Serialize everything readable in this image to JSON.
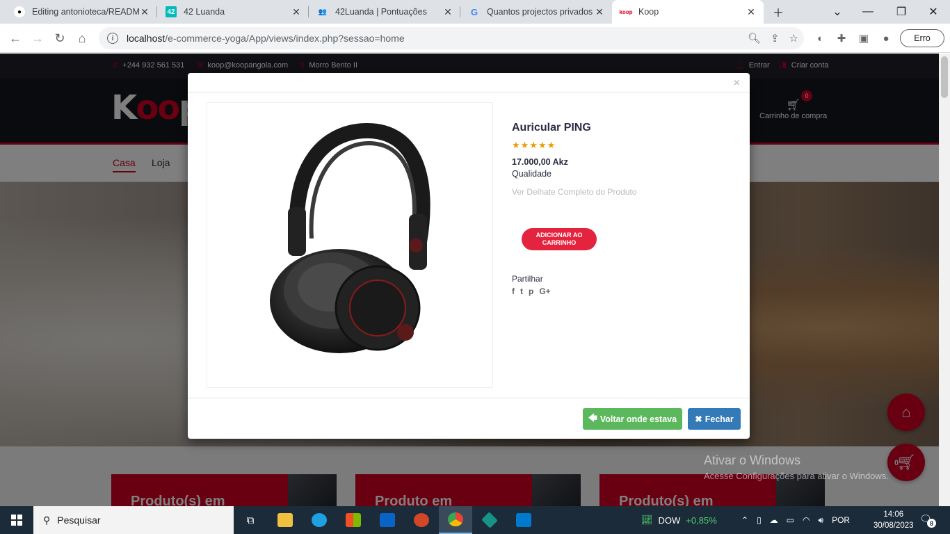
{
  "browser": {
    "tabs": [
      {
        "title": "Editing antonioteca/READMI",
        "favicon": "github-icon"
      },
      {
        "title": "42 Luanda",
        "favicon": "42-icon"
      },
      {
        "title": "42Luanda | Pontuações",
        "favicon": "users-icon"
      },
      {
        "title": "Quantos projectos privados c",
        "favicon": "google-icon"
      },
      {
        "title": "Koop",
        "favicon": "koop-icon",
        "active": true
      }
    ],
    "url_host": "localhost",
    "url_path": "/e-commerce-yoga/App/views/index.php?sessao=home",
    "profile_button": "Erro"
  },
  "site": {
    "topbar": {
      "phone": "+244 932 561 531",
      "email": "koop@koopangola.com",
      "location": "Morro Bento II",
      "login": "Entrar",
      "register": "Criar conta"
    },
    "logo": "Koop",
    "cart": {
      "label": "Carrinho de compra",
      "count": "0"
    },
    "nav": [
      "Casa",
      "Loja"
    ],
    "product_cards": [
      {
        "title": "Produto(s) em"
      },
      {
        "title": "Produto em"
      },
      {
        "title": "Produto(s) em"
      }
    ],
    "floating_cart_count": "0"
  },
  "modal": {
    "close_glyph": "×",
    "product": {
      "name": "Auricular PING",
      "stars": "★★★★★",
      "price": "17.000,00 Akz",
      "quality": "Qualidade",
      "detail_link": "Ver Delhate Completo do Produto",
      "add_to_cart": "ADICIONAR AO CARRINHO"
    },
    "share_label": "Partilhar",
    "share_icons": [
      "f",
      "t",
      "p",
      "G+"
    ],
    "back_button": "Voltar onde estava",
    "close_button": "Fechar"
  },
  "windows": {
    "watermark_title": "Ativar o Windows",
    "watermark_text": "Acesse Configurações para ativar o Windows.",
    "search_placeholder": "Pesquisar",
    "stock_name": "DOW",
    "stock_change": "+0,85%",
    "language": "POR",
    "time": "14:06",
    "date": "30/08/2023",
    "notification_count": "8"
  },
  "colors": {
    "accent": "#d10024",
    "success": "#5cb85c",
    "primary": "#337ab7"
  }
}
